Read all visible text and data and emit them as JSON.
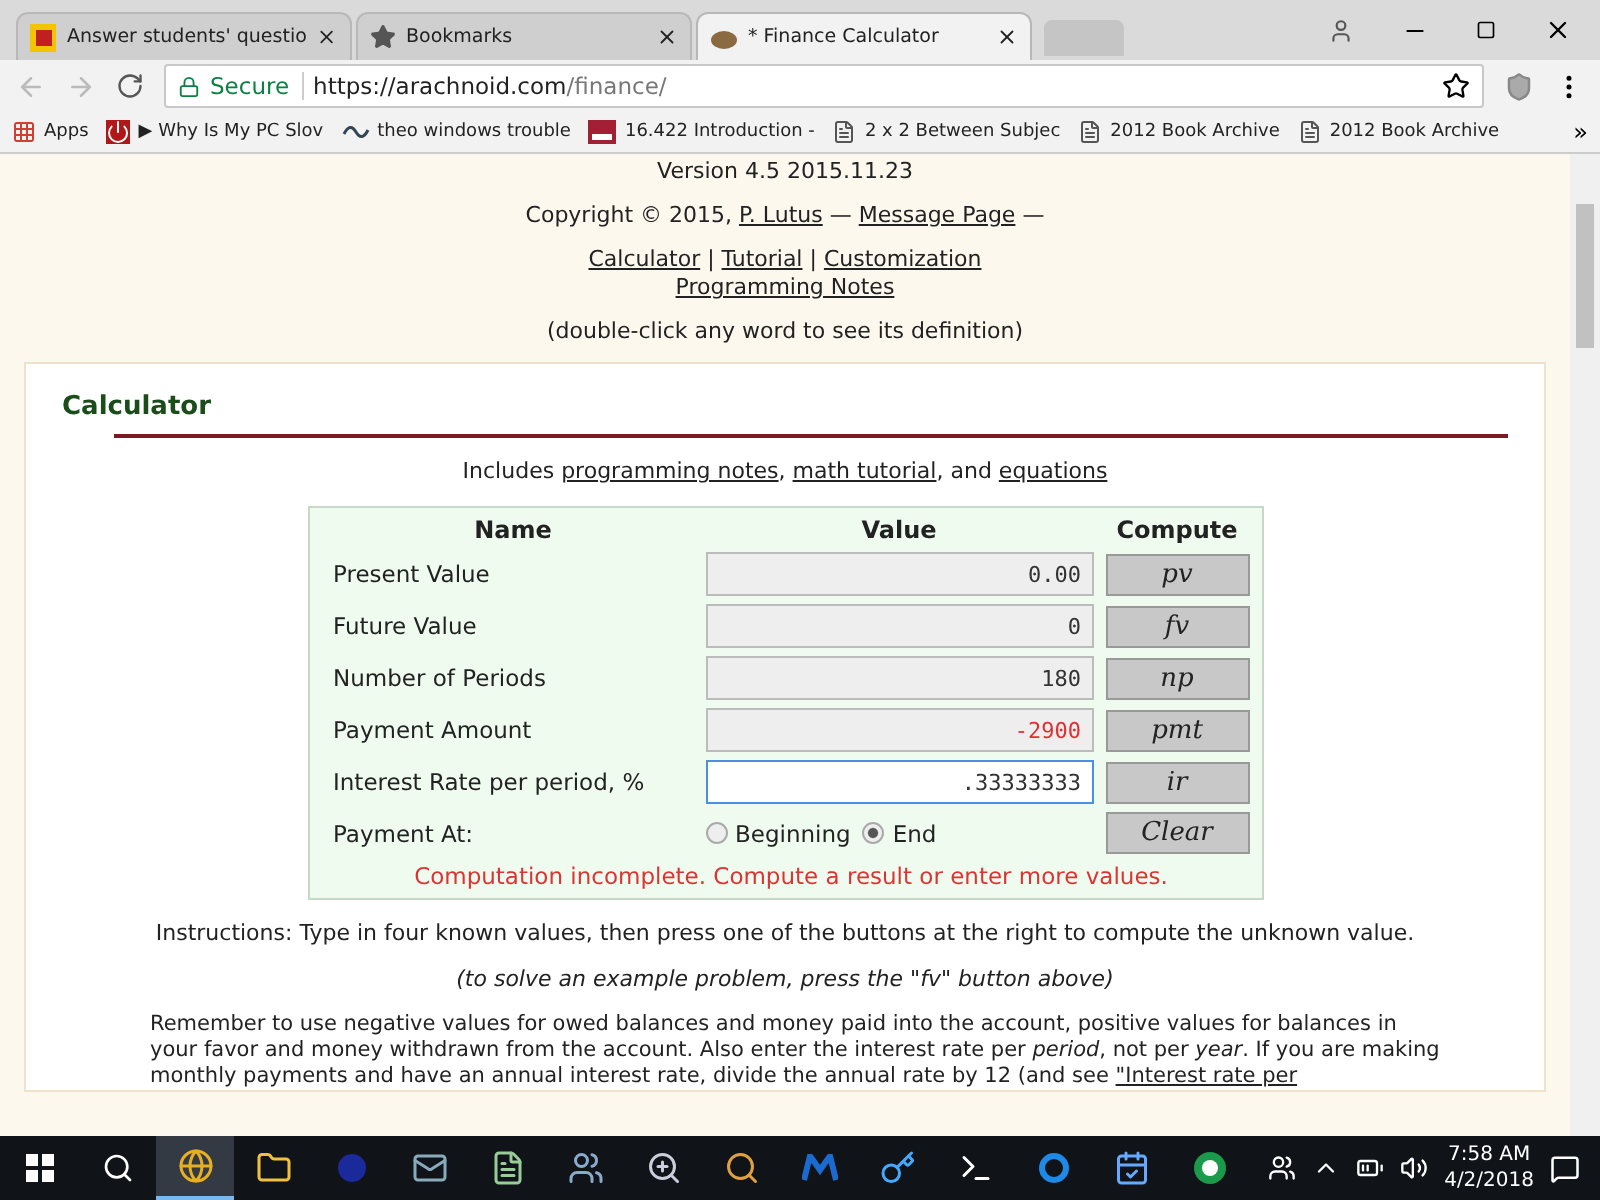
{
  "browser": {
    "tabs": [
      {
        "title": "Answer students' questio",
        "selected": false
      },
      {
        "title": "Bookmarks",
        "selected": false
      },
      {
        "title": "* Finance Calculator",
        "selected": true
      }
    ],
    "address": {
      "secure_label": "Secure",
      "url_host": "https://arachnoid.com",
      "url_path": "/finance/"
    },
    "bookmarks": [
      "Apps",
      "▶ Why Is My PC Slov",
      "theo windows trouble",
      "16.422 Introduction -",
      "2 x 2 Between Subjec",
      "2012 Book Archive",
      "2012 Book Archive"
    ],
    "overflow": "»"
  },
  "page": {
    "version": "Version 4.5 2015.11.23",
    "copyright": [
      {
        "kind": "text",
        "text": "Copyright © 2015, "
      },
      {
        "kind": "link",
        "text": "P. Lutus"
      },
      {
        "kind": "text",
        "text": " — "
      },
      {
        "kind": "link",
        "text": "Message Page"
      },
      {
        "kind": "text",
        "text": " —"
      }
    ],
    "nav": [
      {
        "kind": "link",
        "text": "Calculator"
      },
      {
        "kind": "text",
        "text": " | "
      },
      {
        "kind": "link",
        "text": "Tutorial"
      },
      {
        "kind": "text",
        "text": " | "
      },
      {
        "kind": "link",
        "text": "Customization"
      },
      {
        "kind": "break"
      },
      {
        "kind": "link",
        "text": "Programming Notes"
      }
    ],
    "hint": "(double-click any word to see its definition)",
    "section_title": "Calculator",
    "includes": [
      {
        "kind": "text",
        "text": "Includes "
      },
      {
        "kind": "link",
        "text": "programming notes"
      },
      {
        "kind": "text",
        "text": ", "
      },
      {
        "kind": "link",
        "text": "math tutorial"
      },
      {
        "kind": "text",
        "text": ", and "
      },
      {
        "kind": "link",
        "text": "equations"
      }
    ],
    "calculator": {
      "columns": [
        "Name",
        "Value",
        "Compute"
      ],
      "rows": [
        {
          "name": "Present Value",
          "value": "0.00",
          "button": "pv",
          "focused": false,
          "negative": false
        },
        {
          "name": "Future Value",
          "value": "0",
          "button": "fv",
          "focused": false,
          "negative": false
        },
        {
          "name": "Number of Periods",
          "value": "180",
          "button": "np",
          "focused": false,
          "negative": false
        },
        {
          "name": "Payment Amount",
          "value": "-2900",
          "button": "pmt",
          "focused": false,
          "negative": true
        },
        {
          "name": "Interest Rate per period, %",
          "value": ".33333333",
          "button": "ir",
          "focused": true,
          "negative": false
        }
      ],
      "payment_at": {
        "label": "Payment At:",
        "options": [
          {
            "label": "Beginning",
            "selected": false
          },
          {
            "label": "End",
            "selected": true
          }
        ]
      },
      "clear_button": "Clear",
      "status": "Computation incomplete. Compute a result or enter more values."
    },
    "instructions": "Instructions: Type in four known values, then press one of the buttons at the right to compute the unknown value.",
    "example_note": "(to solve an example problem, press the \"*fv*\" button above)",
    "remember": "Remember to use negative values for owed balances and money paid into the account, positive values for balances in your favor and money withdrawn from the account. Also enter the interest rate per *period*, not per *year*. If you are making monthly payments and have an annual interest rate, divide the annual rate by 12 (and see ",
    "remember_link": "\"Interest rate per"
  },
  "taskbar": {
    "time": "7:58 AM",
    "date": "4/2/2018"
  }
}
